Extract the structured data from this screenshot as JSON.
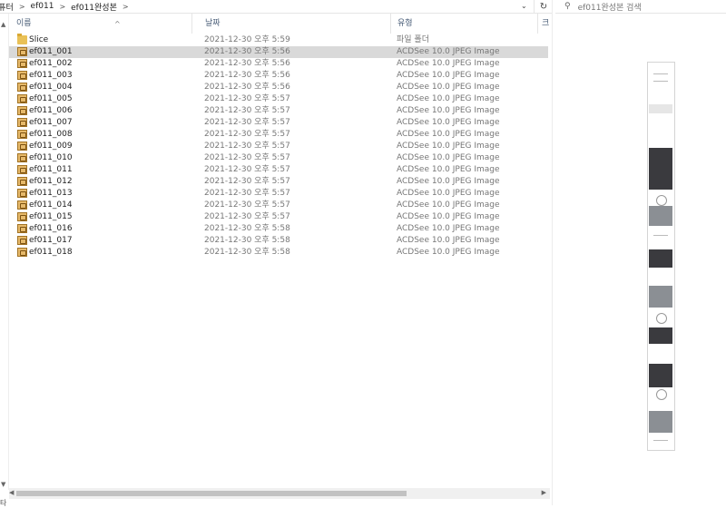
{
  "address_bar": {
    "crumbs": [
      "컴퓨터",
      "ef011",
      "ef011완성본"
    ]
  },
  "search": {
    "placeholder": "ef011완성본 검색"
  },
  "columns": {
    "name": "이름",
    "date": "날짜",
    "type": "유형",
    "extra": "크"
  },
  "files": [
    {
      "name": "Slice",
      "date": "2021-12-30 오후 5:59",
      "type": "파일 폴더",
      "kind": "folder",
      "selected": false
    },
    {
      "name": "ef011_001",
      "date": "2021-12-30 오후 5:56",
      "type": "ACDSee 10.0 JPEG Image",
      "kind": "image",
      "selected": true
    },
    {
      "name": "ef011_002",
      "date": "2021-12-30 오후 5:56",
      "type": "ACDSee 10.0 JPEG Image",
      "kind": "image",
      "selected": false
    },
    {
      "name": "ef011_003",
      "date": "2021-12-30 오후 5:56",
      "type": "ACDSee 10.0 JPEG Image",
      "kind": "image",
      "selected": false
    },
    {
      "name": "ef011_004",
      "date": "2021-12-30 오후 5:56",
      "type": "ACDSee 10.0 JPEG Image",
      "kind": "image",
      "selected": false
    },
    {
      "name": "ef011_005",
      "date": "2021-12-30 오후 5:57",
      "type": "ACDSee 10.0 JPEG Image",
      "kind": "image",
      "selected": false
    },
    {
      "name": "ef011_006",
      "date": "2021-12-30 오후 5:57",
      "type": "ACDSee 10.0 JPEG Image",
      "kind": "image",
      "selected": false
    },
    {
      "name": "ef011_007",
      "date": "2021-12-30 오후 5:57",
      "type": "ACDSee 10.0 JPEG Image",
      "kind": "image",
      "selected": false
    },
    {
      "name": "ef011_008",
      "date": "2021-12-30 오후 5:57",
      "type": "ACDSee 10.0 JPEG Image",
      "kind": "image",
      "selected": false
    },
    {
      "name": "ef011_009",
      "date": "2021-12-30 오후 5:57",
      "type": "ACDSee 10.0 JPEG Image",
      "kind": "image",
      "selected": false
    },
    {
      "name": "ef011_010",
      "date": "2021-12-30 오후 5:57",
      "type": "ACDSee 10.0 JPEG Image",
      "kind": "image",
      "selected": false
    },
    {
      "name": "ef011_011",
      "date": "2021-12-30 오후 5:57",
      "type": "ACDSee 10.0 JPEG Image",
      "kind": "image",
      "selected": false
    },
    {
      "name": "ef011_012",
      "date": "2021-12-30 오후 5:57",
      "type": "ACDSee 10.0 JPEG Image",
      "kind": "image",
      "selected": false
    },
    {
      "name": "ef011_013",
      "date": "2021-12-30 오후 5:57",
      "type": "ACDSee 10.0 JPEG Image",
      "kind": "image",
      "selected": false
    },
    {
      "name": "ef011_014",
      "date": "2021-12-30 오후 5:57",
      "type": "ACDSee 10.0 JPEG Image",
      "kind": "image",
      "selected": false
    },
    {
      "name": "ef011_015",
      "date": "2021-12-30 오후 5:57",
      "type": "ACDSee 10.0 JPEG Image",
      "kind": "image",
      "selected": false
    },
    {
      "name": "ef011_016",
      "date": "2021-12-30 오후 5:58",
      "type": "ACDSee 10.0 JPEG Image",
      "kind": "image",
      "selected": false
    },
    {
      "name": "ef011_017",
      "date": "2021-12-30 오후 5:58",
      "type": "ACDSee 10.0 JPEG Image",
      "kind": "image",
      "selected": false
    },
    {
      "name": "ef011_018",
      "date": "2021-12-30 오후 5:58",
      "type": "ACDSee 10.0 JPEG Image",
      "kind": "image",
      "selected": false
    }
  ],
  "status_bar": {
    "text": "타"
  },
  "icons": {
    "address_dropdown": "chevron-down-icon",
    "refresh": "refresh-icon",
    "search": "search-icon",
    "sort": "sort-ascending-icon",
    "folder": "folder-icon",
    "image": "jpeg-image-icon"
  },
  "colors": {
    "selected_row": "#d9d9d9",
    "header_text": "#4c607a",
    "folder": "#e9c157"
  }
}
